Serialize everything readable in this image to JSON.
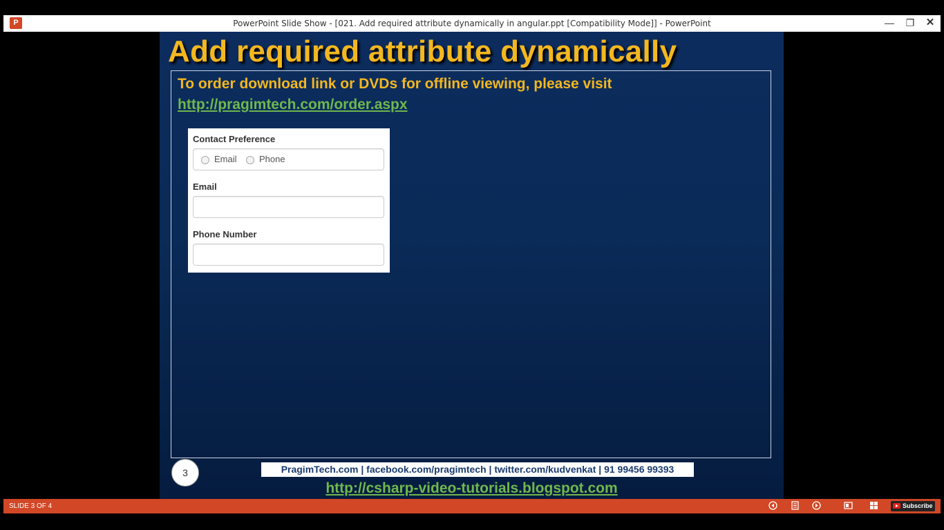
{
  "window": {
    "title": "PowerPoint Slide Show - [021. Add required attribute dynamically in angular.ppt [Compatibility Mode]] - PowerPoint",
    "app_icon": "P",
    "minimize_glyph": "—",
    "restore_glyph": "❐",
    "close_glyph": "✕"
  },
  "slide": {
    "title": "Add required attribute dynamically",
    "order_text": "To order download link or DVDs for offline viewing, please visit",
    "order_link": "http://pragimtech.com/order.aspx",
    "form": {
      "contact_label": "Contact Preference",
      "radio_email": "Email",
      "radio_phone": "Phone",
      "email_label": "Email",
      "email_value": "",
      "phone_label": "Phone Number",
      "phone_value": ""
    },
    "slide_number": "3",
    "footer_text": "PragimTech.com | facebook.com/pragimtech  | twitter.com/kudvenkat  | 91 99456 99393",
    "blog_link": "http://csharp-video-tutorials.blogspot.com"
  },
  "statusbar": {
    "slide_counter": "SLIDE 3 OF 4",
    "subscribe": "Subscribe"
  },
  "colors": {
    "title_yellow": "#f3b71f",
    "link_green": "#6fb84d",
    "slide_blue": "#0a2a57",
    "status_orange": "#d24726"
  }
}
